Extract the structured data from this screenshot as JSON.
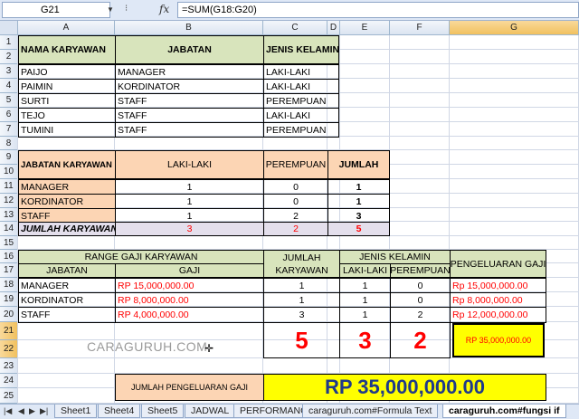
{
  "formula_bar": {
    "name_box": "G21",
    "fx": "fx",
    "formula": "=SUM(G18:G20)"
  },
  "columns": [
    "A",
    "B",
    "C",
    "D",
    "E",
    "F",
    "G"
  ],
  "rows": [
    "1",
    "2",
    "3",
    "4",
    "5",
    "6",
    "7",
    "8",
    "9",
    "10",
    "11",
    "12",
    "13",
    "14",
    "15",
    "16",
    "17",
    "18",
    "19",
    "20",
    "21",
    "22",
    "23",
    "24",
    "25"
  ],
  "table1": {
    "headers": [
      "NAMA KARYAWAN",
      "JABATAN",
      "JENIS KELAMIN"
    ],
    "rows": [
      [
        "PAIJO",
        "MANAGER",
        "LAKI-LAKI"
      ],
      [
        "PAIMIN",
        "KORDINATOR",
        "LAKI-LAKI"
      ],
      [
        "SURTI",
        "STAFF",
        "PEREMPUAN"
      ],
      [
        "TEJO",
        "STAFF",
        "LAKI-LAKI"
      ],
      [
        "TUMINI",
        "STAFF",
        "PEREMPUAN"
      ]
    ]
  },
  "table2": {
    "headers": [
      "JABATAN KARYAWAN",
      "LAKI-LAKI",
      "PEREMPUAN",
      "JUMLAH"
    ],
    "rows": [
      [
        "MANAGER",
        "1",
        "0",
        "1"
      ],
      [
        "KORDINATOR",
        "1",
        "0",
        "1"
      ],
      [
        "STAFF",
        "1",
        "2",
        "3"
      ]
    ],
    "total": [
      "JUMLAH KARYAWAN",
      "3",
      "2",
      "5"
    ]
  },
  "table3": {
    "range_title": "RANGE GAJI KARYAWAN",
    "jabatan": "JABATAN",
    "gaji": "GAJI",
    "jumlah_karyawan_1": "JUMLAH",
    "jumlah_karyawan_2": "KARYAWAN",
    "jenis_kelamin": "JENIS KELAMIN",
    "laki": "LAKI-LAKI",
    "perempuan": "PEREMPUAN",
    "pengeluaran": "PENGELUARAN GAJI",
    "rows": [
      [
        "MANAGER",
        "RP 15,000,000.00",
        "1",
        "1",
        "0",
        "Rp 15,000,000.00"
      ],
      [
        "KORDINATOR",
        "RP 8,000,000.00",
        "1",
        "1",
        "0",
        "Rp 8,000,000.00"
      ],
      [
        "STAFF",
        "RP 4,000,000.00",
        "3",
        "1",
        "2",
        "Rp 12,000,000.00"
      ]
    ],
    "totals": [
      "5",
      "3",
      "2",
      "RP 35,000,000.00"
    ]
  },
  "summary": {
    "label": "JUMLAH PENGELUARAN GAJI",
    "value": "RP 35,000,000.00"
  },
  "watermark": "CARAGURUH.COM",
  "sheet_tabs": [
    "Sheet1",
    "Sheet4",
    "Sheet5",
    "JADWAL",
    "PERFORMANCE",
    "caraguruh.com#Formula Text",
    "caraguruh.com#fungsi if"
  ],
  "colors": {
    "accent_red": "#ff0000",
    "header_green": "#d8e4bc",
    "header_peach": "#fcd5b4",
    "yellow": "#ffff00"
  }
}
